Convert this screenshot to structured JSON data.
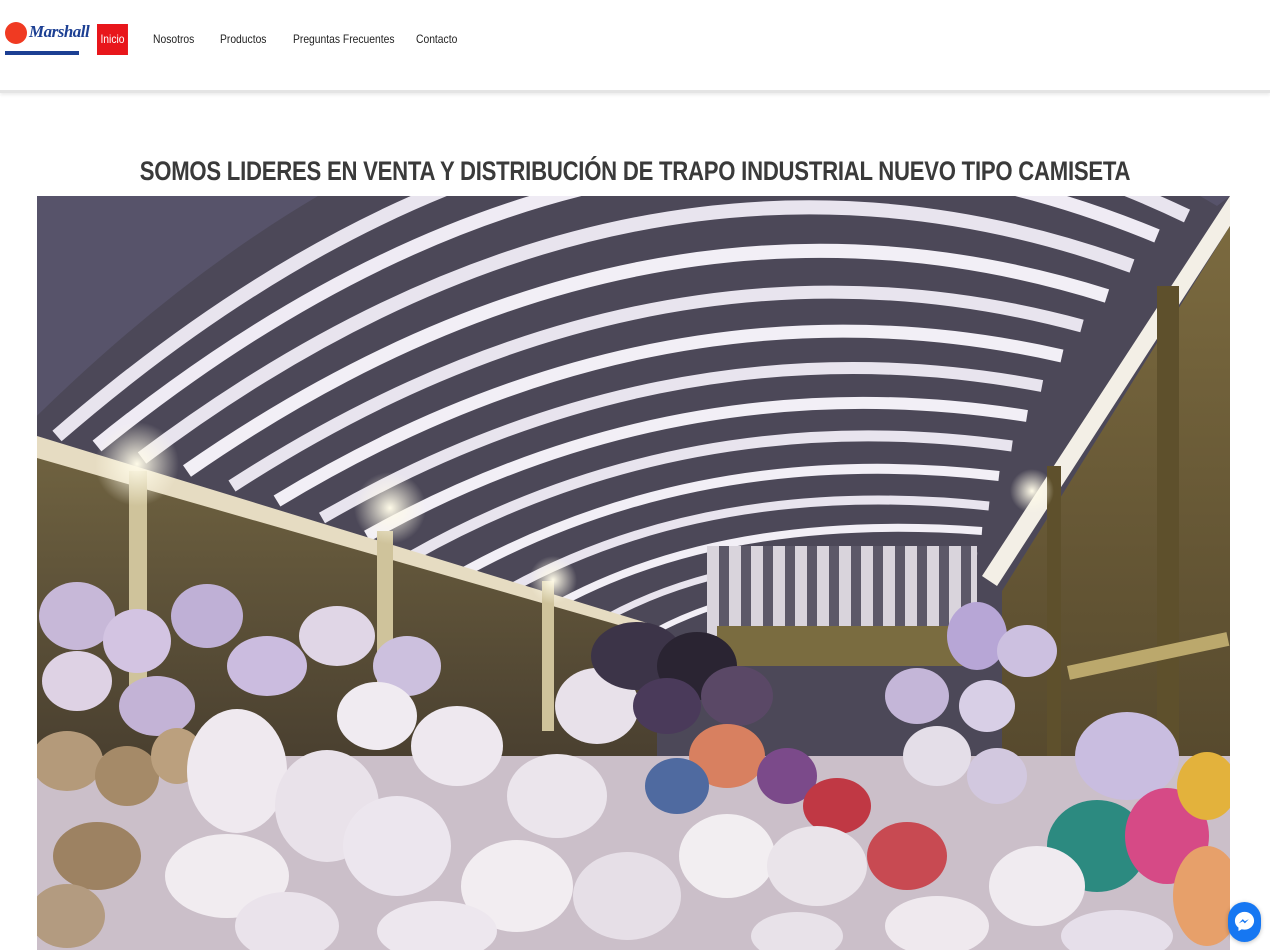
{
  "brand": {
    "logo_text": "Marshall"
  },
  "nav": {
    "items": [
      {
        "label": "Inicio",
        "active": true
      },
      {
        "label": "Nosotros",
        "active": false
      },
      {
        "label": "Productos",
        "active": false
      },
      {
        "label": "Preguntas Frecuentes",
        "active": false
      },
      {
        "label": "Contacto",
        "active": false
      }
    ]
  },
  "hero": {
    "headline": "SOMOS LIDERES EN VENTA Y DISTRIBUCIÓN DE TRAPO INDUSTRIAL NUEVO TIPO CAMISETA"
  },
  "colors": {
    "accent": "#e8161b",
    "brand_blue": "#1c3f93",
    "messenger": "#1677f2"
  },
  "icons": {
    "chat": "messenger-icon"
  }
}
